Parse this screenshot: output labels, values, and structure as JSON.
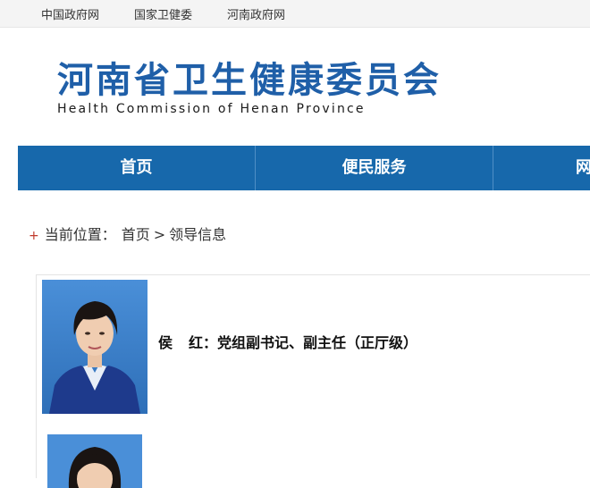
{
  "top_links": [
    "中国政府网",
    "国家卫健委",
    "河南政府网"
  ],
  "header": {
    "title": "河南省卫生健康委员会",
    "subtitle": "Health Commission of Henan Province"
  },
  "nav": {
    "items": [
      "首页",
      "便民服务",
      "网"
    ]
  },
  "breadcrumb": {
    "label": "当前位置：",
    "home": "首页",
    "separator": ">",
    "current": "领导信息"
  },
  "leaders": [
    {
      "name_part1": "侯",
      "name_part2": "红：",
      "title": "党组副书记、副主任（正厅级）"
    }
  ],
  "colors": {
    "brand_blue": "#1f5fa8",
    "nav_blue": "#1768ab",
    "photo_bg": "#3f7fc7"
  }
}
